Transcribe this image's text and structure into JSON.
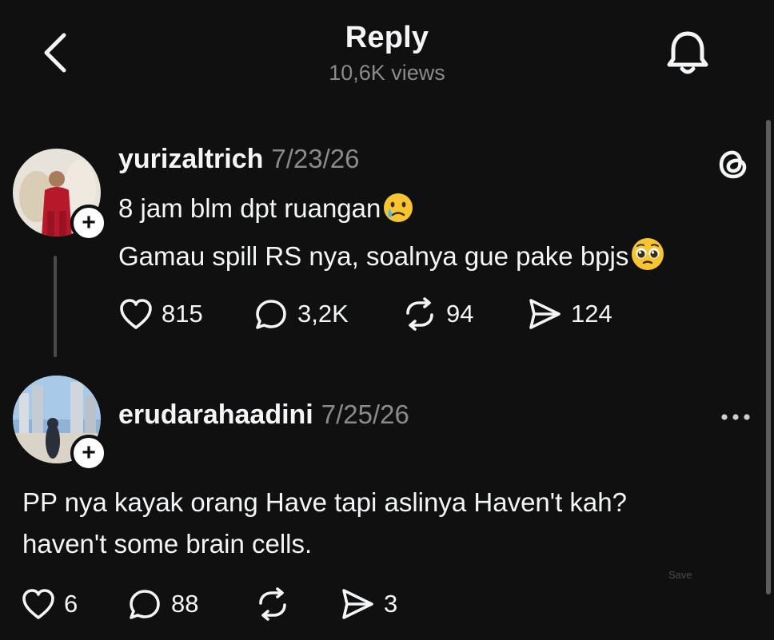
{
  "header": {
    "title": "Reply",
    "views": "10,6K views"
  },
  "posts": [
    {
      "username": "yurizaltrich",
      "date": "7/23/26",
      "lines": [
        "8 jam blm dpt ruangan",
        "Gamau spill RS nya, soalnya gue pake bpjs"
      ],
      "emojis": [
        "crying-face",
        "pleading-face"
      ],
      "stats": {
        "likes": "815",
        "replies": "3,2K",
        "reposts": "94",
        "shares": "124"
      }
    },
    {
      "username": "erudarahaadini",
      "date": "7/25/26",
      "lines": [
        "PP nya kayak orang Have tapi aslinya Haven't kah?",
        "haven't some brain cells."
      ],
      "stats": {
        "likes": "6",
        "replies": "88",
        "reposts": "",
        "shares": "3"
      }
    }
  ],
  "save_label": "Save",
  "colors": {
    "background": "#101010",
    "text": "#f3f5f7",
    "muted": "#8a8a8a"
  }
}
